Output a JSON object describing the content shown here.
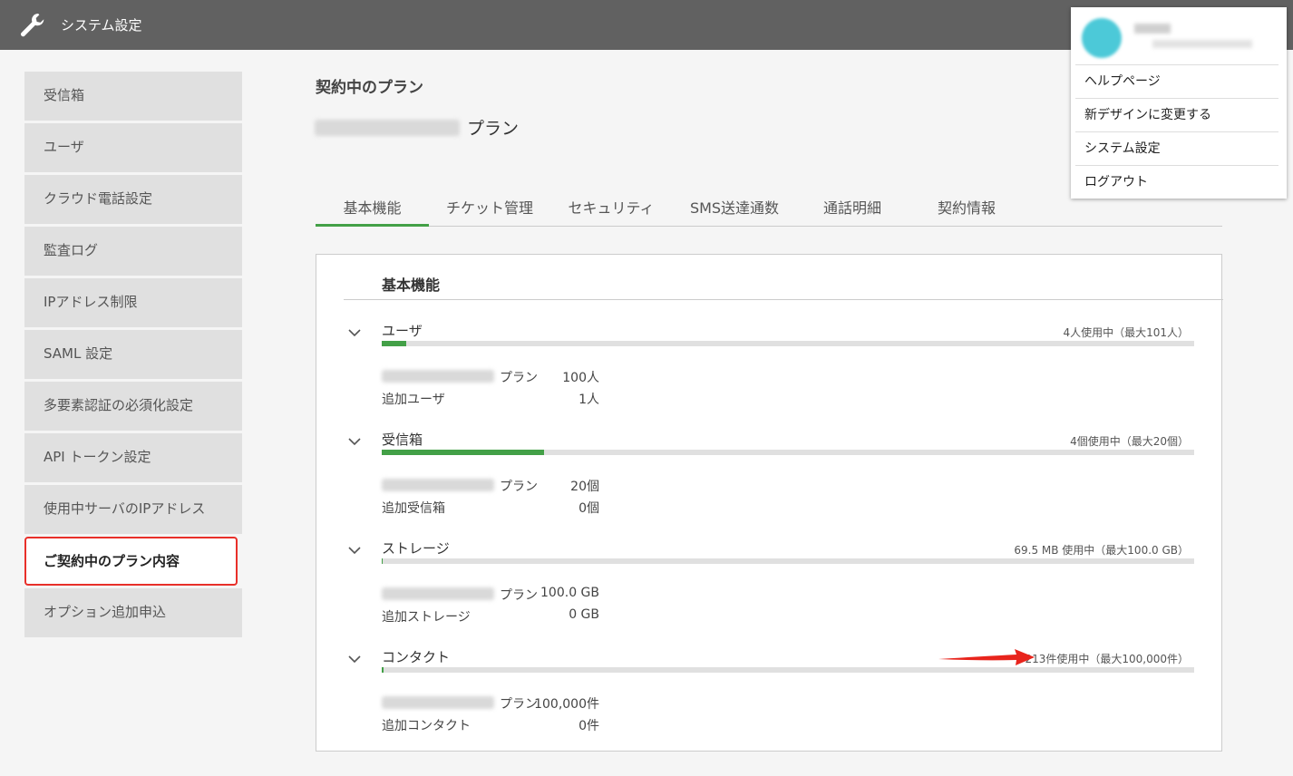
{
  "header": {
    "title": "システム設定"
  },
  "sidebar": {
    "items": [
      {
        "label": "受信箱"
      },
      {
        "label": "ユーザ"
      },
      {
        "label": "クラウド電話設定"
      },
      {
        "label": "監査ログ"
      },
      {
        "label": "IPアドレス制限"
      },
      {
        "label": "SAML 設定"
      },
      {
        "label": "多要素認証の必須化設定"
      },
      {
        "label": "API トークン設定"
      },
      {
        "label": "使用中サーバのIPアドレス"
      },
      {
        "label": "ご契約中のプラン内容"
      },
      {
        "label": "オプション追加申込"
      }
    ]
  },
  "main": {
    "heading": "契約中のプラン",
    "plan_suffix": "プラン",
    "tabs": [
      {
        "label": "基本機能"
      },
      {
        "label": "チケット管理"
      },
      {
        "label": "セキュリティ"
      },
      {
        "label": "SMS送達通数"
      },
      {
        "label": "通話明細"
      },
      {
        "label": "契約情報"
      }
    ],
    "panel": {
      "title": "基本機能",
      "sections": [
        {
          "name": "ユーザ",
          "usage": "4人使用中（最大101人）",
          "fill_fraction": 0.03,
          "plan_label": "プラン",
          "plan_value": "100人",
          "extra_label": "追加ユーザ",
          "extra_value": "1人"
        },
        {
          "name": "受信箱",
          "usage": "4個使用中（最大20個）",
          "fill_fraction": 0.2,
          "plan_label": "プラン",
          "plan_value": "20個",
          "extra_label": "追加受信箱",
          "extra_value": "0個"
        },
        {
          "name": "ストレージ",
          "usage": "69.5 MB 使用中（最大100.0 GB）",
          "fill_fraction": 0.0007,
          "plan_label": "プラン",
          "plan_value": "100.0 GB",
          "extra_label": "追加ストレージ",
          "extra_value": "0 GB"
        },
        {
          "name": "コンタクト",
          "usage": "213件使用中（最大100,000件）",
          "fill_fraction": 0.002,
          "plan_label": "プラン",
          "plan_value": "100,000件",
          "extra_label": "追加コンタクト",
          "extra_value": "0件"
        }
      ]
    }
  },
  "user_menu": {
    "items": [
      {
        "label": "ヘルプページ"
      },
      {
        "label": "新デザインに変更する"
      },
      {
        "label": "システム設定"
      },
      {
        "label": "ログアウト"
      }
    ]
  },
  "colors": {
    "accent_green": "#43a047",
    "highlight_red": "#e8302a",
    "header_gray": "#616161",
    "avatar_teal": "#4cc9d8"
  }
}
